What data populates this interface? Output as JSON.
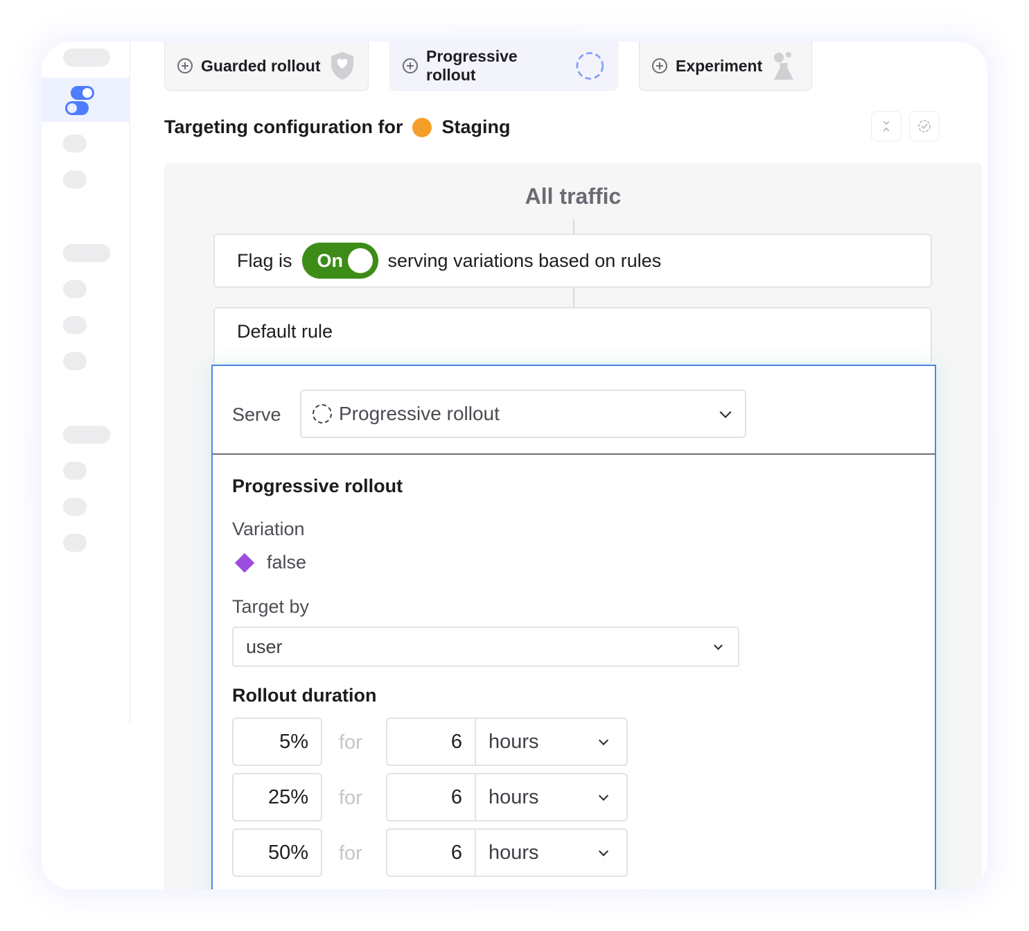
{
  "tabs": [
    {
      "label": "Guarded rollout",
      "icon": "shield-icon"
    },
    {
      "label": "Progressive rollout",
      "icon": "dashed-circle-icon"
    },
    {
      "label": "Experiment",
      "icon": "experiment-icon"
    }
  ],
  "header": {
    "title": "Targeting configuration for",
    "environment": "Staging",
    "environment_color": "#f59e2a"
  },
  "panel": {
    "title": "All traffic",
    "flag_prefix": "Flag is",
    "flag_state": "On",
    "flag_suffix": "serving variations based on rules",
    "default_rule": "Default rule"
  },
  "editor": {
    "serve_label": "Serve",
    "serve_value": "Progressive rollout",
    "section_title": "Progressive rollout",
    "variation_label": "Variation",
    "variation_value": "false",
    "variation_color": "#9b4de0",
    "target_label": "Target by",
    "target_value": "user",
    "duration_title": "Rollout duration",
    "steps": [
      {
        "percent": "5%",
        "for": "for",
        "amount": "6",
        "unit": "hours"
      },
      {
        "percent": "25%",
        "for": "for",
        "amount": "6",
        "unit": "hours"
      },
      {
        "percent": "50%",
        "for": "for",
        "amount": "6",
        "unit": "hours"
      }
    ]
  },
  "colors": {
    "accent": "#4f7dff",
    "toggle_on": "#3d8c17",
    "editor_border": "#4b86e8"
  }
}
